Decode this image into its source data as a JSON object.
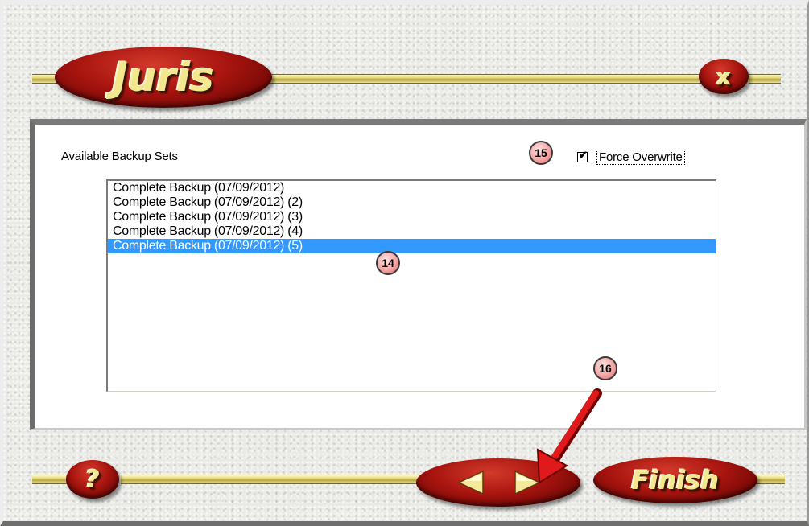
{
  "header": {
    "logo_text": "Juris",
    "close_label": "x"
  },
  "main": {
    "available_label": "Available Backup Sets",
    "force_overwrite": {
      "label": "Force Overwrite",
      "checked": true
    },
    "backup_sets": [
      {
        "label": "Complete Backup (07/09/2012)",
        "selected": false
      },
      {
        "label": "Complete Backup (07/09/2012) (2)",
        "selected": false
      },
      {
        "label": "Complete Backup (07/09/2012) (3)",
        "selected": false
      },
      {
        "label": "Complete Backup (07/09/2012) (4)",
        "selected": false
      },
      {
        "label": "Complete Backup (07/09/2012) (5)",
        "selected": true
      }
    ]
  },
  "callouts": {
    "list": "14",
    "checkbox": "15",
    "next": "16"
  },
  "footer": {
    "help_label": "?",
    "finish_label": "Finish"
  },
  "icons": {
    "back": "triangle-left-icon",
    "next": "triangle-right-icon",
    "arrow": "red-pointer-arrow-icon"
  },
  "colors": {
    "oval_red": "#a8140f",
    "rail_gold": "#e8dc7a",
    "selection_blue": "#3399ff",
    "callout_pink": "#f5a6a6"
  }
}
